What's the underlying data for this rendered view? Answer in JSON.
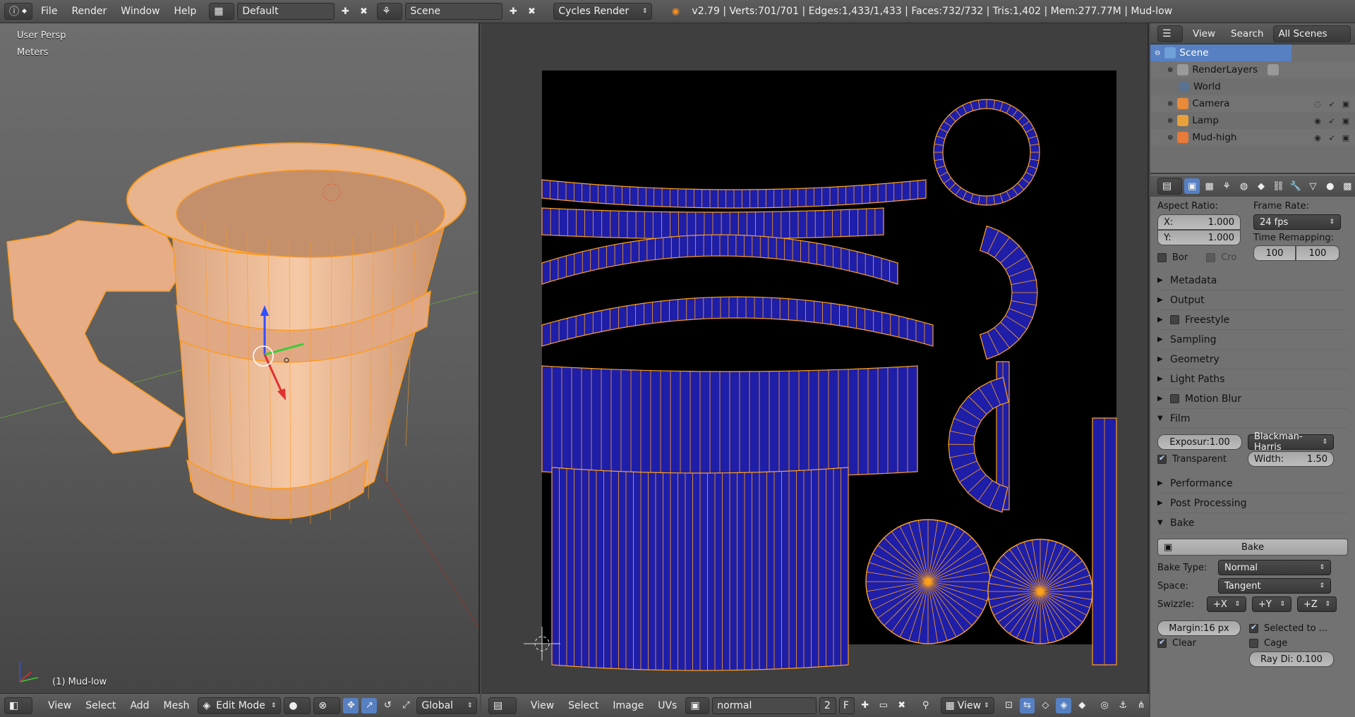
{
  "topbar": {
    "menus": [
      "File",
      "Render",
      "Window",
      "Help"
    ],
    "layout_name": "Default",
    "scene_name": "Scene",
    "engine": "Cycles Render",
    "stats": "v2.79 | Verts:701/701 | Edges:1,433/1,433 | Faces:732/732 | Tris:1,402 | Mem:277.77M | Mud-low"
  },
  "viewport3d": {
    "view_name": "User Persp",
    "units": "Meters",
    "object_label": "(1) Mud-low",
    "header": {
      "menus": [
        "View",
        "Select",
        "Add",
        "Mesh"
      ],
      "mode": "Edit Mode",
      "orientation": "Global"
    }
  },
  "uv_editor": {
    "header": {
      "menus": [
        "View",
        "Select",
        "Image",
        "UVs"
      ],
      "image_name": "normal",
      "users": "2",
      "fake_user": "F",
      "view_dropdown": "View"
    },
    "uv_fill": "#1e1ea8",
    "uv_edge": "#ffa21a"
  },
  "outliner": {
    "header": {
      "menus": [
        "View",
        "Search"
      ],
      "filter": "All Scenes"
    },
    "items": [
      {
        "label": "Scene",
        "selected": true
      },
      {
        "label": "RenderLayers"
      },
      {
        "label": "World"
      },
      {
        "label": "Camera"
      },
      {
        "label": "Lamp"
      },
      {
        "label": "Mud-high"
      }
    ]
  },
  "properties": {
    "aspect_ratio_label": "Aspect Ratio:",
    "aspect_x_label": "X:",
    "aspect_x": "1.000",
    "aspect_y_label": "Y:",
    "aspect_y": "1.000",
    "frame_rate_label": "Frame Rate:",
    "frame_rate": "24 fps",
    "time_remap_label": "Time Remapping:",
    "time_old": "100",
    "time_new": "100",
    "border_label": "Bor",
    "crop_label": "Cro",
    "panels_top": [
      "Metadata",
      "Output",
      "Freestyle",
      "Sampling",
      "Geometry",
      "Light Paths",
      "Motion Blur",
      "Film"
    ],
    "film": {
      "exposure": "Exposur:1.00",
      "filter": "Blackman-Harris",
      "transparent_label": "Transparent",
      "width": "Width:",
      "width_value": "1.50"
    },
    "panels_mid": [
      "Performance",
      "Post Processing",
      "Bake"
    ],
    "bake": {
      "bake_button": "Bake",
      "bake_type_label": "Bake Type:",
      "bake_type": "Normal",
      "space_label": "Space:",
      "space": "Tangent",
      "swizzle_label": "Swizzle:",
      "swizzle": [
        "+X",
        "+Y",
        "+Z"
      ],
      "margin": "Margin:16 px",
      "selected_to_active": "Selected to ...",
      "clear_label": "Clear",
      "cage_label": "Cage",
      "ray_distance": "Ray Di: 0.100"
    }
  }
}
